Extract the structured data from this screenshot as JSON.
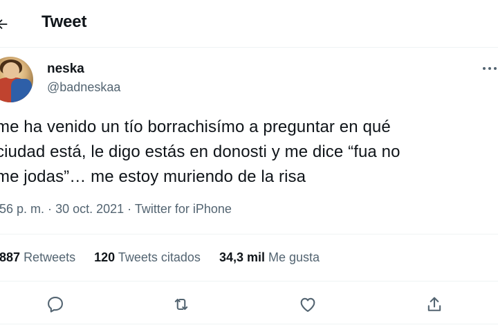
{
  "header": {
    "title": "Tweet"
  },
  "author": {
    "display_name": "neska",
    "handle": "@badneskaa"
  },
  "tweet": {
    "lines": [
      "me ha venido un tío borrachisímo a preguntar en qué",
      "ciudad está, le digo estás en donosti y me dice “fua no",
      "me jodas”… me estoy muriendo de la risa"
    ],
    "time": ":56 p. m.",
    "date": "30 oct. 2021",
    "source": "Twitter for iPhone",
    "separator": "·"
  },
  "stats": [
    {
      "value": ".887",
      "label": "Retweets"
    },
    {
      "value": "120",
      "label": "Tweets citados"
    },
    {
      "value": "34,3 mil",
      "label": "Me gusta"
    }
  ],
  "actions": [
    "reply-icon",
    "retweet-icon",
    "like-icon",
    "share-icon"
  ],
  "colors": {
    "text": "#0f1419",
    "secondary": "#536471",
    "divider": "#eff3f4"
  }
}
